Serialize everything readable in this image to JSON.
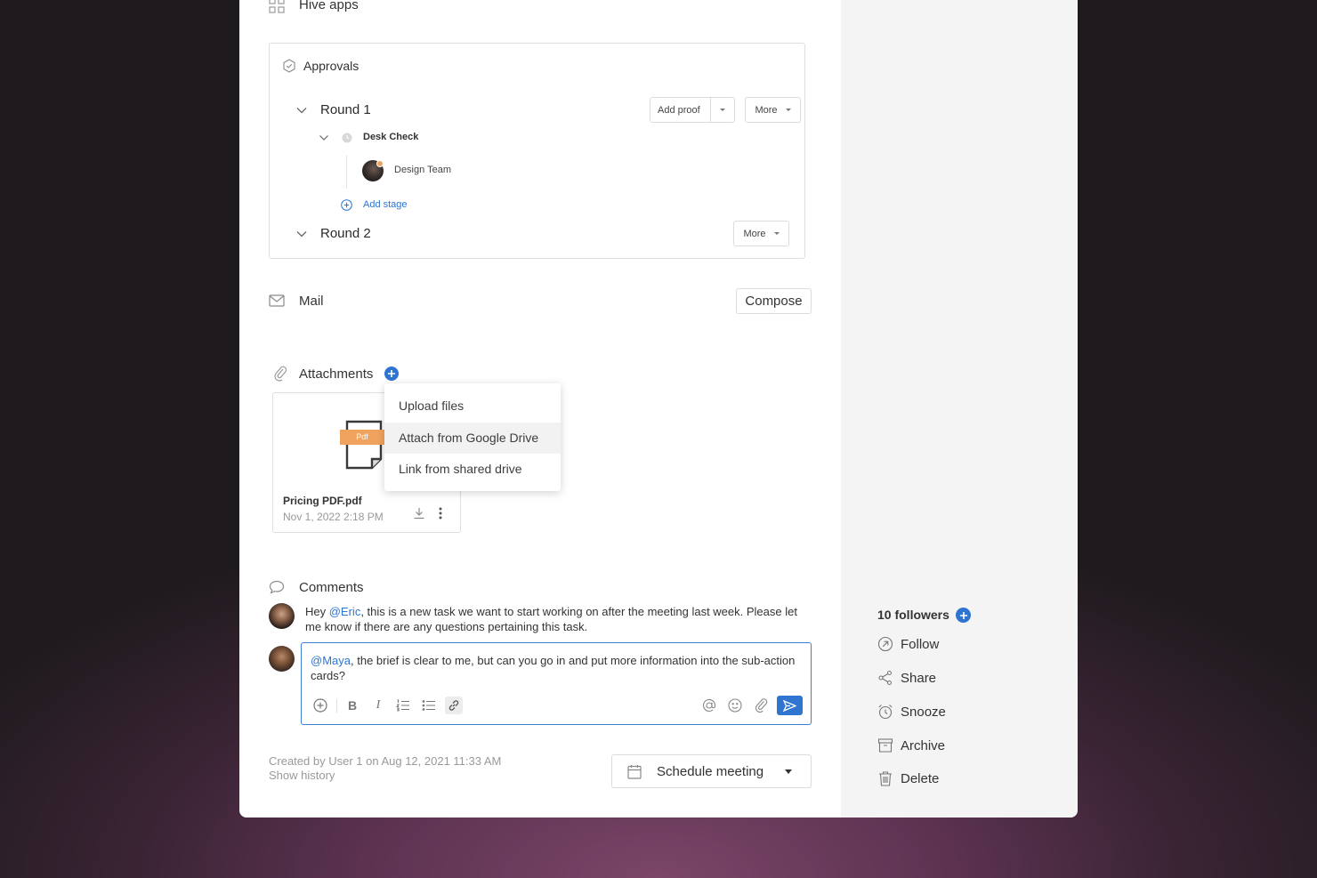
{
  "hive_apps": {
    "label": "Hive apps"
  },
  "approvals": {
    "title": "Approvals",
    "rounds": [
      {
        "label": "Round 1",
        "add_proof_label": "Add proof",
        "more_label": "More"
      },
      {
        "label": "Round 2",
        "more_label": "More"
      }
    ],
    "stage": {
      "label": "Desk Check",
      "assignee": "Design Team"
    },
    "add_stage_label": "Add stage"
  },
  "mail": {
    "title": "Mail",
    "compose_label": "Compose"
  },
  "attachments": {
    "title": "Attachments",
    "file": {
      "badge": "Pdf",
      "name": "Pricing PDF.pdf",
      "date": "Nov 1, 2022 2:18 PM"
    },
    "menu": {
      "items": [
        "Upload files",
        "Attach from Google Drive",
        "Link from shared drive"
      ],
      "hovered_index": 1
    }
  },
  "comments": {
    "title": "Comments",
    "comment": {
      "prefix": "Hey ",
      "mention": "@Eric",
      "text": ", this is a new task we want to start working on after the meeting last week. Please let me know if there are any questions pertaining this task."
    },
    "reply": {
      "mention": "@Maya",
      "text": ", the brief is clear to me, but can you go in and put more information into the sub-action cards?"
    },
    "toolbar_icons": [
      "plus-circle-icon",
      "bold-icon",
      "italic-icon",
      "numbered-list-icon",
      "bullet-list-icon",
      "link-icon",
      "at-icon",
      "emoji-icon",
      "paperclip-icon",
      "send-icon"
    ]
  },
  "footer": {
    "created": "Created by User 1 on Aug 12, 2021 11:33 AM",
    "show_history": "Show history",
    "schedule_label": "Schedule meeting"
  },
  "sidebar": {
    "followers_label": "10 followers",
    "actions": [
      {
        "label": "Follow",
        "icon": "follow-icon"
      },
      {
        "label": "Share",
        "icon": "share-icon"
      },
      {
        "label": "Snooze",
        "icon": "alarm-icon"
      },
      {
        "label": "Archive",
        "icon": "archive-icon"
      },
      {
        "label": "Delete",
        "icon": "trash-icon"
      }
    ]
  },
  "colors": {
    "accent": "#2f74d0",
    "send_button": "#2f74d0",
    "pdf_badge": "#f0a35e"
  }
}
